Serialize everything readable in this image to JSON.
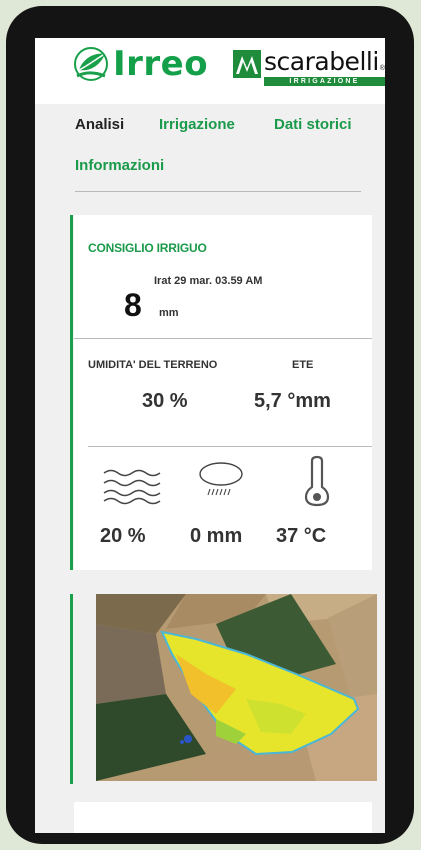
{
  "brand": {
    "app_name": "Irreo",
    "partner_name": "scarabelli",
    "partner_tagline": "IRRIGAZIONE",
    "partner_registered": "®",
    "accent_color": "#1aa04a"
  },
  "tabs": [
    {
      "label": "Analisi",
      "active": true
    },
    {
      "label": "Irrigazione",
      "active": false
    },
    {
      "label": "Dati storici",
      "active": false
    },
    {
      "label": "Informazioni",
      "active": false
    }
  ],
  "advice_card": {
    "title": "CONSIGLIO IRRIGUO",
    "timestamp": "Irat 29 mar. 03.59 AM",
    "amount_value": "8",
    "amount_unit": "mm",
    "soil_moisture_label": "UMIDITA' DEL TERRENO",
    "soil_moisture_value": "30 %",
    "ete_label": "ETE",
    "ete_value": "5,7 °mm",
    "humidity_icon": "wind-waves-icon",
    "humidity_value": "20 %",
    "rain_icon": "cloud-rain-icon",
    "rain_value": "0 mm",
    "temperature_icon": "thermometer-icon",
    "temperature_value": "37 °C"
  },
  "map_card": {
    "image": "satellite-field-map"
  }
}
